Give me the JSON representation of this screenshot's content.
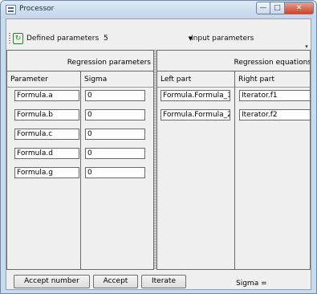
{
  "window": {
    "title": "Processor",
    "min_glyph": "—",
    "max_glyph": "□",
    "close_glyph": "✕"
  },
  "toolbar": {
    "defined_label": "Defined parameters",
    "defined_value": "5",
    "input_label": "Input parameters",
    "refresh_glyph": "↻",
    "combo_arrow": "▼",
    "overflow_glyph": "▾"
  },
  "regression_parameters": {
    "title": "Regression parameters",
    "parameter_header": "Parameter",
    "sigma_header": "Sigma",
    "rows": [
      {
        "parameter": "Formula.a",
        "sigma": "0"
      },
      {
        "parameter": "Formula.b",
        "sigma": "0"
      },
      {
        "parameter": "Formula.c",
        "sigma": "0"
      },
      {
        "parameter": "Formula.d",
        "sigma": "0"
      },
      {
        "parameter": "Formula.g",
        "sigma": "0"
      }
    ]
  },
  "regression_equations": {
    "title": "Regression equations",
    "left_header": "Left part",
    "right_header": "Right part",
    "rows": [
      {
        "left": "Formula.Formula_1",
        "right": "Iterator.f1"
      },
      {
        "left": "Formula.Formula_2",
        "right": "Iterator.f2"
      }
    ]
  },
  "footer": {
    "accept_number_label": "Accept number",
    "accept_label": "Accept",
    "iterate_label": "Iterate",
    "sigma_label": "Sigma ="
  }
}
